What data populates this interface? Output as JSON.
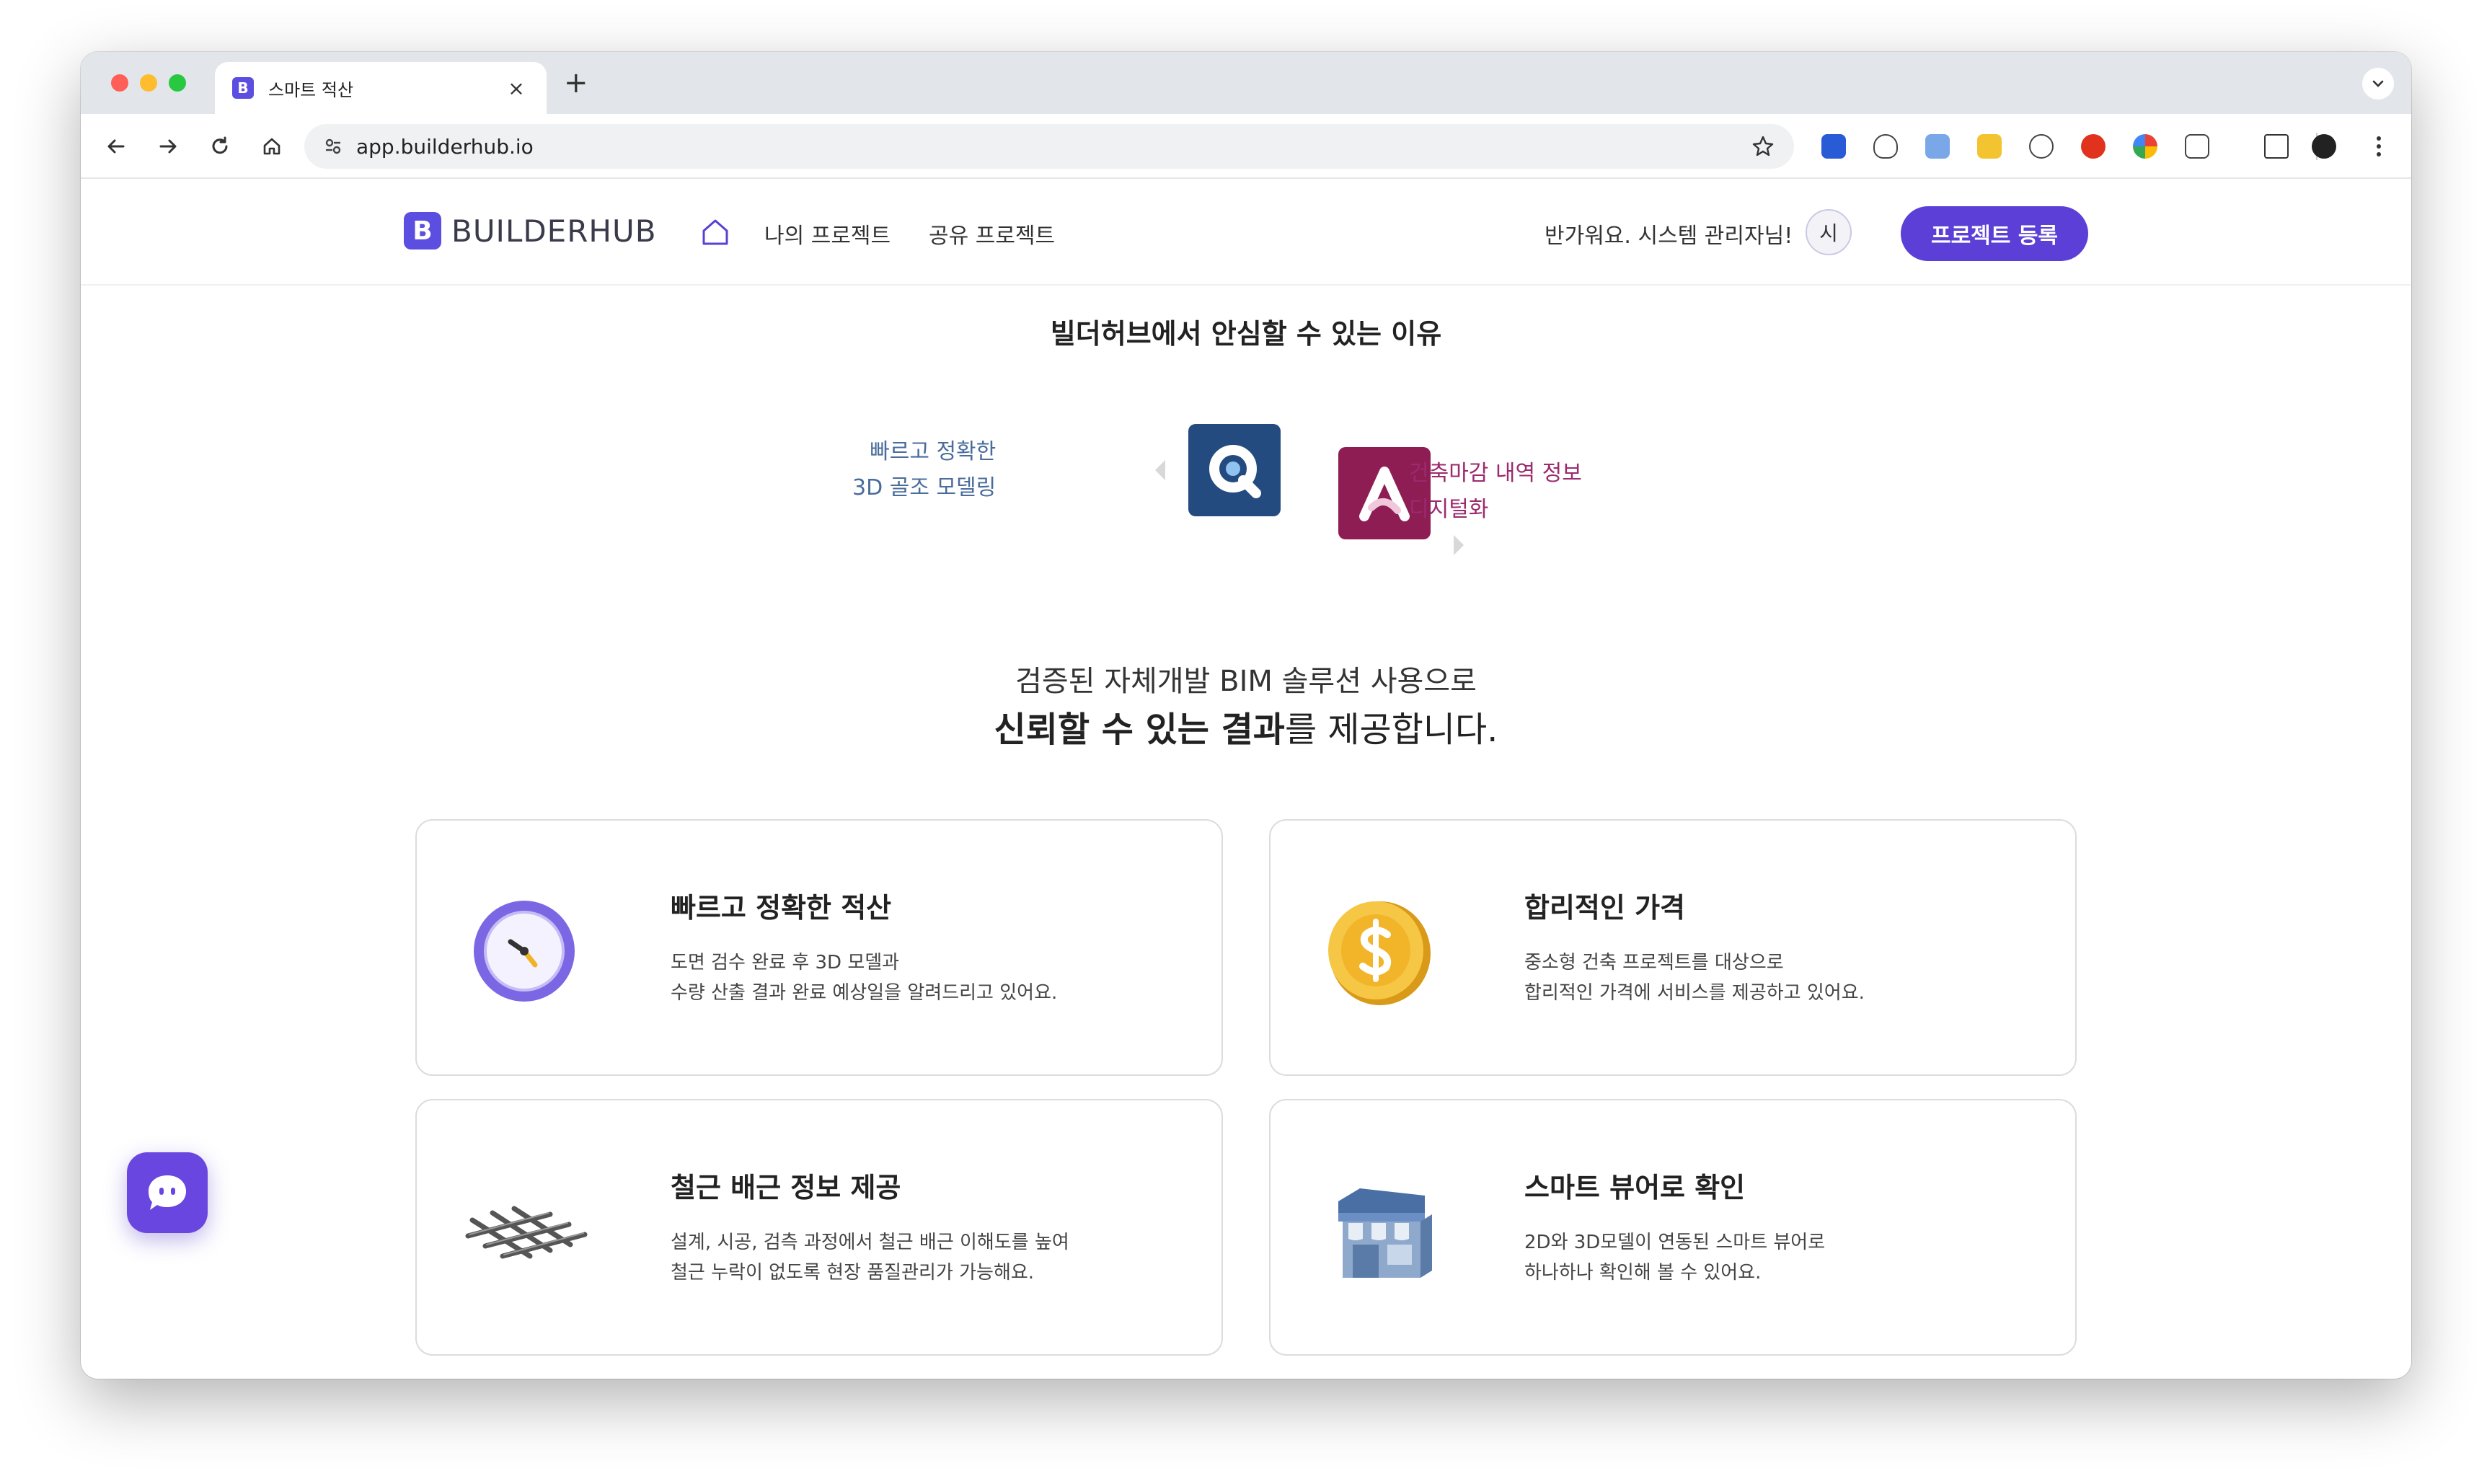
{
  "browser": {
    "tab_title": "스마트 적산",
    "tab_favicon": "B",
    "close_glyph": "×",
    "newtab_glyph": "+",
    "url": "app.builderhub.io",
    "icons": [
      "back-arrow-icon",
      "forward-arrow-icon",
      "reload-icon",
      "home-icon",
      "site-settings-icon",
      "bookmark-star-icon",
      "extensions-icon",
      "sidebar-icon",
      "profile-icon",
      "more-icon"
    ]
  },
  "site": {
    "logo_mark": "B",
    "logo_text": "BUILDERHUB",
    "nav": {
      "my_projects": "나의 프로젝트",
      "shared_projects": "공유 프로젝트"
    },
    "greeting": "반가워요. 시스템 관리자님!",
    "avatar_initial": "시",
    "register_button": "프로젝트 등록",
    "accent_color": "#5b3fd6"
  },
  "hero": {
    "title": "빌더허브에서 안심할 수 있는 이유",
    "left_feature": [
      "빠르고 정확한",
      "3D 골조 모델링"
    ],
    "right_feature": [
      "건축마감 내역 정보",
      "디지털화"
    ],
    "tagline_line1": "검증된 자체개발 BIM 솔루션 사용으로",
    "tagline_bold": "신뢰할 수 있는 결과",
    "tagline_rest": "를 제공합니다."
  },
  "cards": [
    {
      "title": "빠르고 정확한 적산",
      "desc": [
        "도면 검수 완료 후 3D 모델과",
        "수량 산출 결과 완료 예상일을 알려드리고 있어요."
      ],
      "icon": "clock-icon"
    },
    {
      "title": "합리적인 가격",
      "desc": [
        "중소형 건축 프로젝트를 대상으로",
        "합리적인 가격에 서비스를 제공하고 있어요."
      ],
      "icon": "coin-icon"
    },
    {
      "title": "철근 배근 정보 제공",
      "desc": [
        "설계, 시공, 검측 과정에서 철근 배근 이해도를 높여",
        "철근 누락이 없도록 현장 품질관리가 가능해요."
      ],
      "icon": "rebar-mesh-icon"
    },
    {
      "title": "스마트 뷰어로 확인",
      "desc": [
        "2D와 3D모델이 연동된 스마트 뷰어로",
        "하나하나 확인해 볼 수 있어요."
      ],
      "icon": "store-icon"
    }
  ]
}
